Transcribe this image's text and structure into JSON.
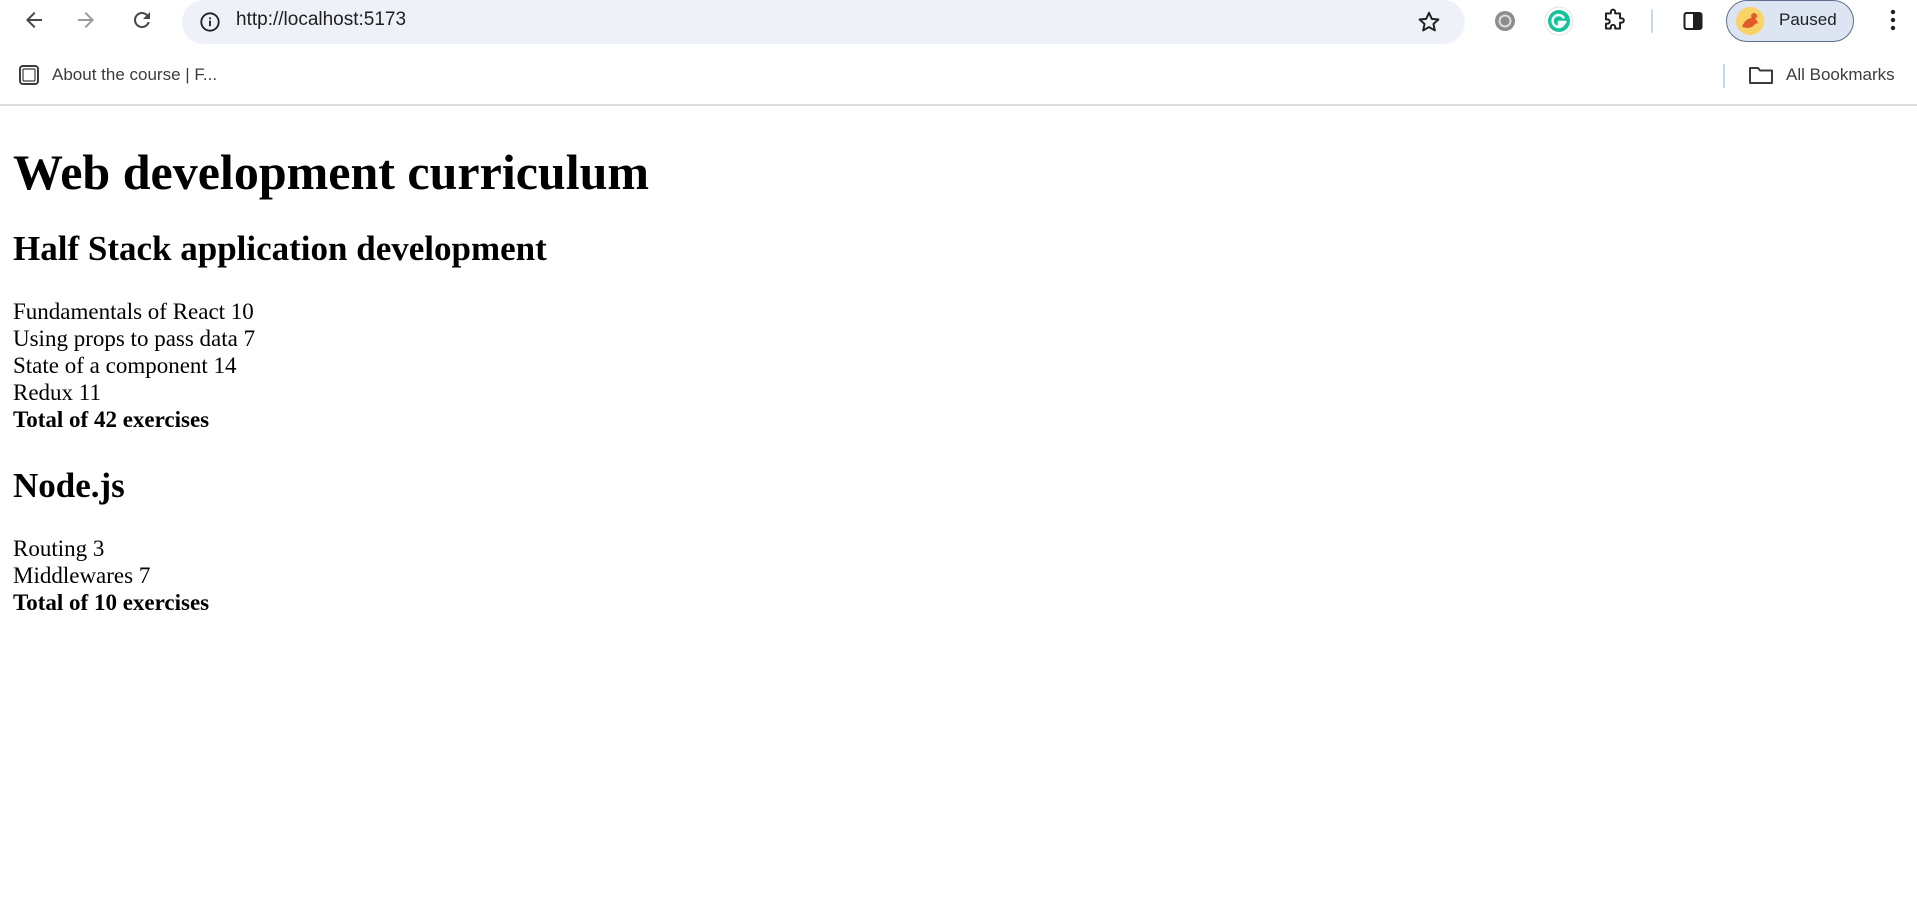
{
  "browser": {
    "url": "http://localhost:5173",
    "profile_label": "Paused",
    "bookmarks": [
      {
        "label": "About the course | F..."
      }
    ],
    "all_bookmarks_label": "All Bookmarks"
  },
  "page": {
    "title": "Web development curriculum",
    "courses": [
      {
        "name": "Half Stack application development",
        "parts": [
          {
            "text": "Fundamentals of React 10"
          },
          {
            "text": "Using props to pass data 7"
          },
          {
            "text": "State of a component 14"
          },
          {
            "text": "Redux 11"
          }
        ],
        "total": "Total of 42 exercises"
      },
      {
        "name": "Node.js",
        "parts": [
          {
            "text": "Routing 3"
          },
          {
            "text": "Middlewares 7"
          }
        ],
        "total": "Total of 10 exercises"
      }
    ]
  },
  "colors": {
    "omnibox_bg": "#eef1f8",
    "profile_chip_bg": "#dde5f3",
    "grammarly_green": "#15c39a"
  }
}
